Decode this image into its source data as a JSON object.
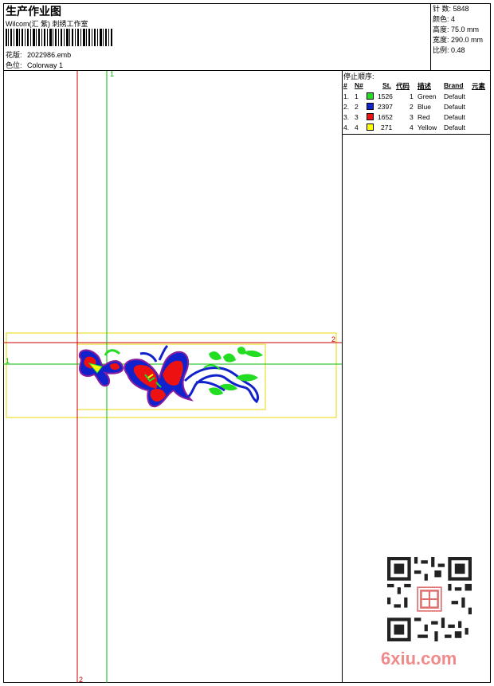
{
  "header": {
    "title": "生产作业图",
    "company": "Wilcom(汇 紫) 刺绣工作室",
    "design_label": "花版:",
    "design_value": "2022986.emb",
    "colorway_label": "色位:",
    "colorway_value": "Colorway 1"
  },
  "stats": {
    "stitches_label": "针 数:",
    "stitches_value": "5848",
    "colors_label": "颜色:",
    "colors_value": "4",
    "height_label": "高度:",
    "height_value": "75.0 mm",
    "width_label": "宽度:",
    "width_value": "290.0 mm",
    "scale_label": "比例:",
    "scale_value": "0.48"
  },
  "stop_sequence": {
    "title": "停止顺序:",
    "headers": {
      "num": "#",
      "n": "N#",
      "st": "St.",
      "code": "代码",
      "desc": "描述",
      "brand": "Brand",
      "element": "元素"
    },
    "rows": [
      {
        "num": "1.",
        "n": "1",
        "color": "#22dd22",
        "st": "1526",
        "code": "1",
        "desc": "Green",
        "brand": "Default"
      },
      {
        "num": "2.",
        "n": "2",
        "color": "#1122cc",
        "st": "2397",
        "code": "2",
        "desc": "Blue",
        "brand": "Default"
      },
      {
        "num": "3.",
        "n": "3",
        "color": "#ee1111",
        "st": "1652",
        "code": "3",
        "desc": "Red",
        "brand": "Default"
      },
      {
        "num": "4.",
        "n": "4",
        "color": "#ffff00",
        "st": "271",
        "code": "4",
        "desc": "Yellow",
        "brand": "Default"
      }
    ]
  },
  "canvas": {
    "marker_green_top": "1",
    "marker_green_left": "1",
    "marker_red_right": "2",
    "marker_red_bottom": "2"
  },
  "watermark": {
    "text": "6xiu.com"
  },
  "colors": {
    "green": "#22dd22",
    "blue": "#1122cc",
    "red": "#ee1111",
    "yellow": "#ffff00",
    "crosshair_red": "#cc0000",
    "crosshair_green": "#00bb00"
  }
}
